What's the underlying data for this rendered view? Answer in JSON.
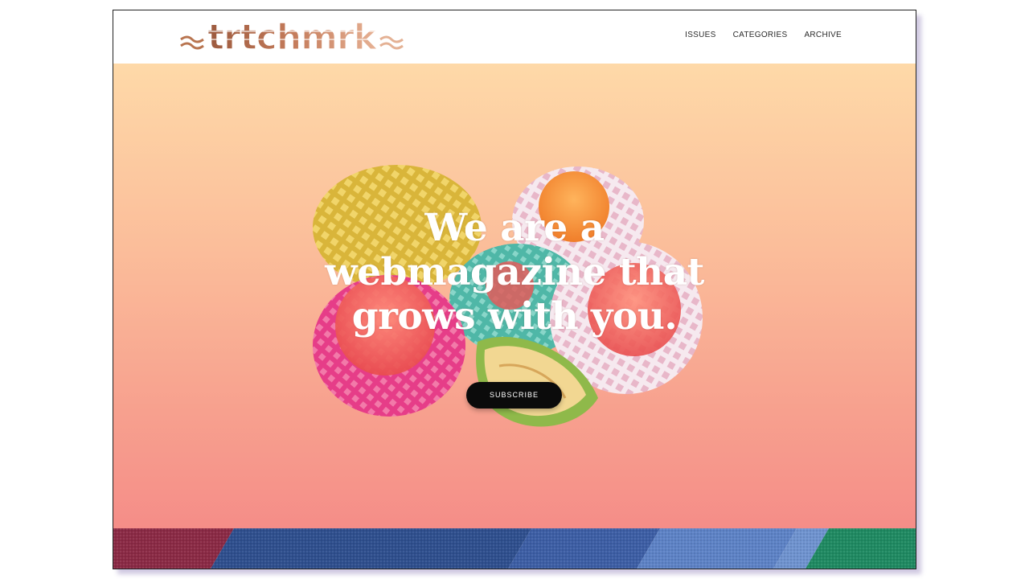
{
  "site": {
    "logo_text": "strtchmrk",
    "logo_icon": "strtchmrk-wordmark-logo"
  },
  "nav": {
    "items": [
      {
        "label": "ISSUES"
      },
      {
        "label": "CATEGORIES"
      },
      {
        "label": "ARCHIVE"
      }
    ]
  },
  "hero": {
    "headline_line1": "We are a",
    "headline_line2": "webmagazine that",
    "headline_line3": "grows with you.",
    "cta_label": "SUBSCRIBE",
    "image_icon": "fruits-in-foam-nets-image",
    "gradient_top": "#fed9a8",
    "gradient_bottom": "#f58d88"
  },
  "footer_strip": {
    "image_icon": "striped-fabric-image"
  },
  "colors": {
    "button_bg": "#0b0b0b",
    "logo_brown": "#a8603f",
    "logo_peach": "#e1a07e"
  }
}
